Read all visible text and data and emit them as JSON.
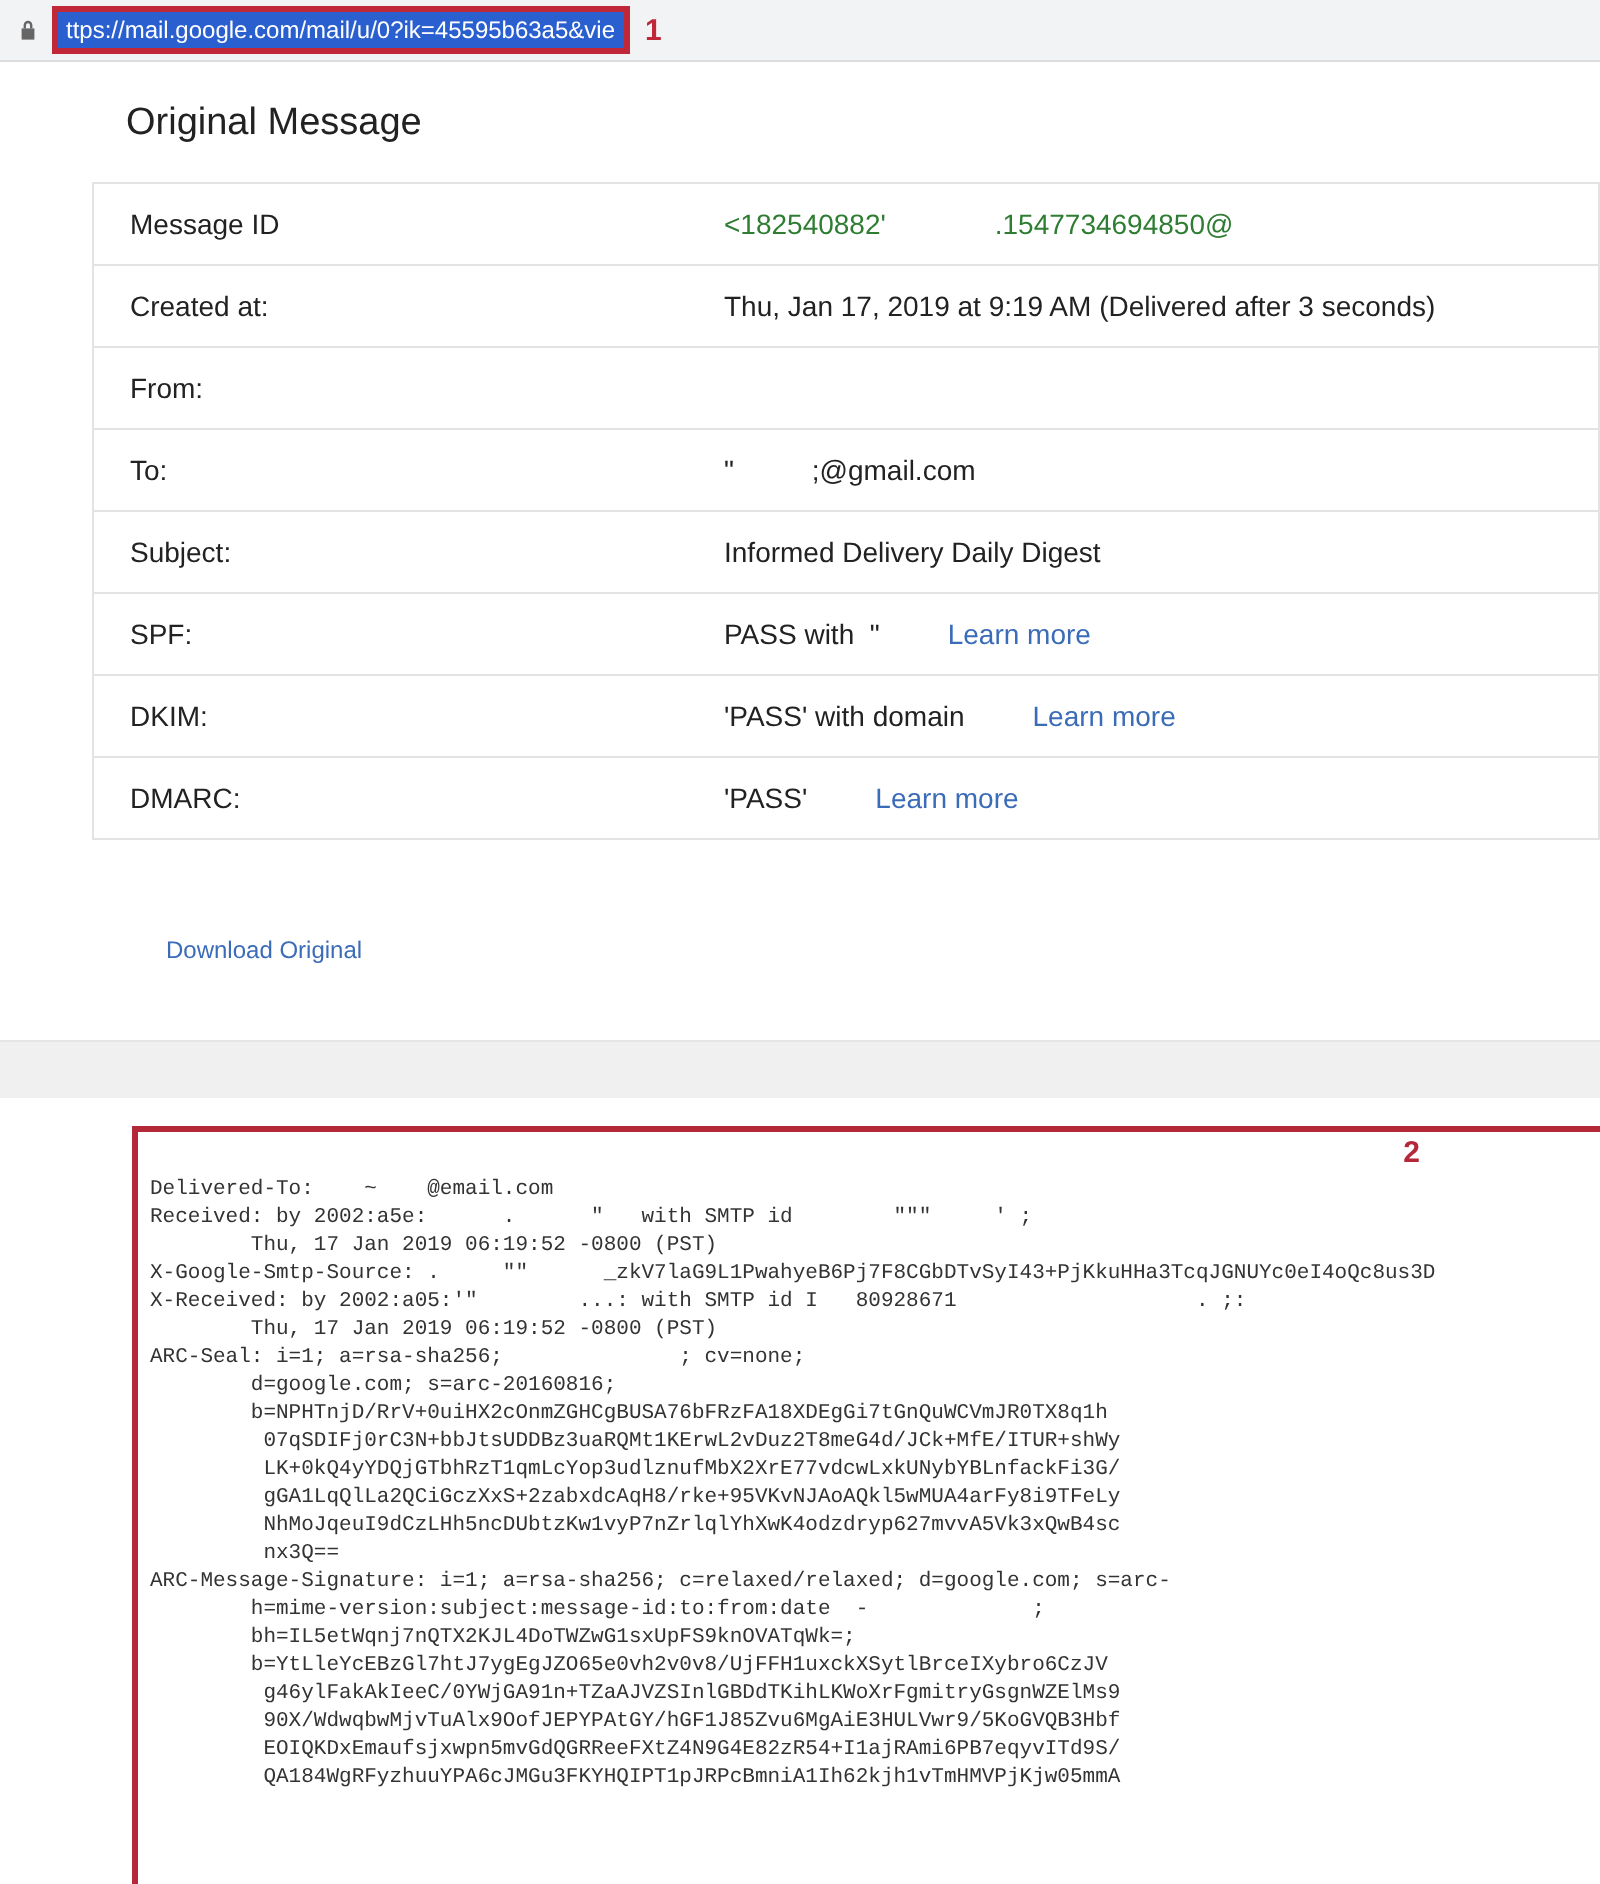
{
  "address_bar": {
    "url": "ttps://mail.google.com/mail/u/0?ik=45595b63a5&vie",
    "selected": true,
    "annotation": "1"
  },
  "title": "Original Message",
  "rows": [
    {
      "label": "Message ID",
      "kind": "id",
      "value": "<182540882'              .1547734694850@"
    },
    {
      "label": "Created at:",
      "kind": "text",
      "value": "Thu, Jan 17, 2019 at 9:19 AM (Delivered after 3 seconds)"
    },
    {
      "label": "From:"
    },
    {
      "label": "To:",
      "kind": "text",
      "value": "\"          ;@gmail.com"
    },
    {
      "label": "Subject:",
      "kind": "text",
      "value": "Informed Delivery Daily Digest"
    },
    {
      "label": "SPF:",
      "kind": "text",
      "value": "PASS with  \"",
      "link": "Learn more"
    },
    {
      "label": "DKIM:",
      "kind": "text",
      "value": "'PASS' with domain",
      "link": "Learn more"
    },
    {
      "label": "DMARC:",
      "kind": "text",
      "value": "'PASS'",
      "link": "Learn more"
    }
  ],
  "download_link": "Download Original",
  "source": {
    "annotation": "2",
    "lines": [
      "Delivered-To:    ~    @email.com",
      "Received: by 2002:a5e:      .      \"   with SMTP id        \"\"\"     ' ;",
      "        Thu, 17 Jan 2019 06:19:52 -0800 (PST)",
      "X-Google-Smtp-Source: .     \"\"      _zkV7laG9L1PwahyeB6Pj7F8CGbDTvSyI43+PjKkuHHa3TcqJGNUYc0eI4oQc8us3D",
      "X-Received: by 2002:a05:'\"        ...: with SMTP id I   80928671                   . ;:",
      "        Thu, 17 Jan 2019 06:19:52 -0800 (PST)",
      "ARC-Seal: i=1; a=rsa-sha256;              ; cv=none;",
      "        d=google.com; s=arc-20160816;",
      "        b=NPHTnjD/RrV+0uiHX2cOnmZGHCgBUSA76bFRzFA18XDEgGi7tGnQuWCVmJR0TX8q1h",
      "         07qSDIFj0rC3N+bbJtsUDDBz3uaRQMt1KErwL2vDuz2T8meG4d/JCk+MfE/ITUR+shWy",
      "         LK+0kQ4yYDQjGTbhRzT1qmLcYop3udlznufMbX2XrE77vdcwLxkUNybYBLnfackFi3G/",
      "         gGA1LqQlLa2QCiGczXxS+2zabxdcAqH8/rke+95VKvNJAoAQkl5wMUA4arFy8i9TFeLy",
      "         NhMoJqeuI9dCzLHh5ncDUbtzKw1vyP7nZrlqlYhXwK4odzdryp627mvvA5Vk3xQwB4sc",
      "         nx3Q==",
      "ARC-Message-Signature: i=1; a=rsa-sha256; c=relaxed/relaxed; d=google.com; s=arc-",
      "        h=mime-version:subject:message-id:to:from:date  -             ;",
      "        bh=IL5etWqnj7nQTX2KJL4DoTWZwG1sxUpFS9knOVATqWk=;",
      "        b=YtLleYcEBzGl7htJ7ygEgJZO65e0vh2v0v8/UjFFH1uxckXSytlBrceIXybro6CzJV",
      "         g46ylFakAkIeeC/0YWjGA91n+TZaAJVZSInlGBDdTKihLKWoXrFgmitryGsgnWZElMs9",
      "         90X/WdwqbwMjvTuAlx9OofJEPYPAtGY/hGF1J85Zvu6MgAiE3HULVwr9/5KoGVQB3Hbf",
      "         EOIQKDxEmaufsjxwpn5mvGdQGRReeFXtZ4N9G4E82zR54+I1ajRAmi6PB7eqyvITd9S/",
      "         QA184WgRFyzhuuYPA6cJMGu3FKYHQIPT1pJRPcBmniA1Ih62kjh1vTmHMVPjKjw05mmA"
    ]
  }
}
